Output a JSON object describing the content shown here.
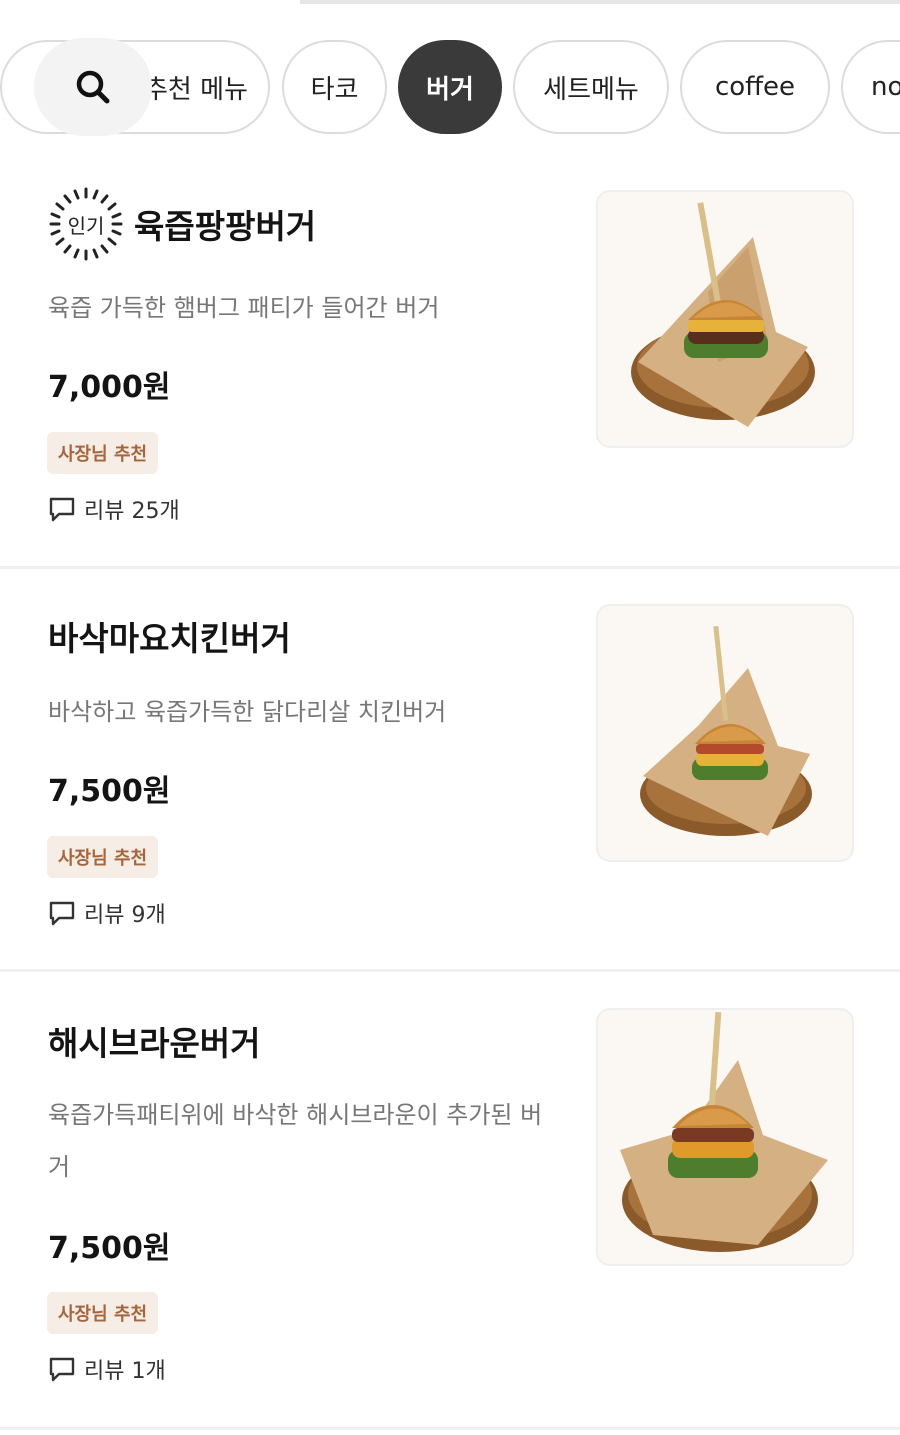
{
  "categories": [
    {
      "label": "추천 메뉴",
      "active": false
    },
    {
      "label": "타코",
      "active": false
    },
    {
      "label": "버거",
      "active": true
    },
    {
      "label": "세트메뉴",
      "active": false
    },
    {
      "label": "coffee",
      "active": false
    },
    {
      "label": "no",
      "active": false
    }
  ],
  "search": {
    "icon": "search-icon"
  },
  "menu_items": [
    {
      "popular_label": "인기",
      "name": "육즙팡팡버거",
      "description": "육즙 가득한 햄버그 패티가 들어간 버거",
      "price": "7,000원",
      "badge": "사장님 추천",
      "review": "리뷰 25개"
    },
    {
      "name": "바삭마요치킨버거",
      "description": "바삭하고 육즙가득한 닭다리살 치킨버거",
      "price": "7,500원",
      "badge": "사장님 추천",
      "review": "리뷰 9개"
    },
    {
      "name": "해시브라운버거",
      "description": "육즙가득패티위에 바삭한 해시브라운이 추가된 버거",
      "price": "7,500원",
      "badge": "사장님 추천",
      "review": "리뷰 1개"
    }
  ]
}
